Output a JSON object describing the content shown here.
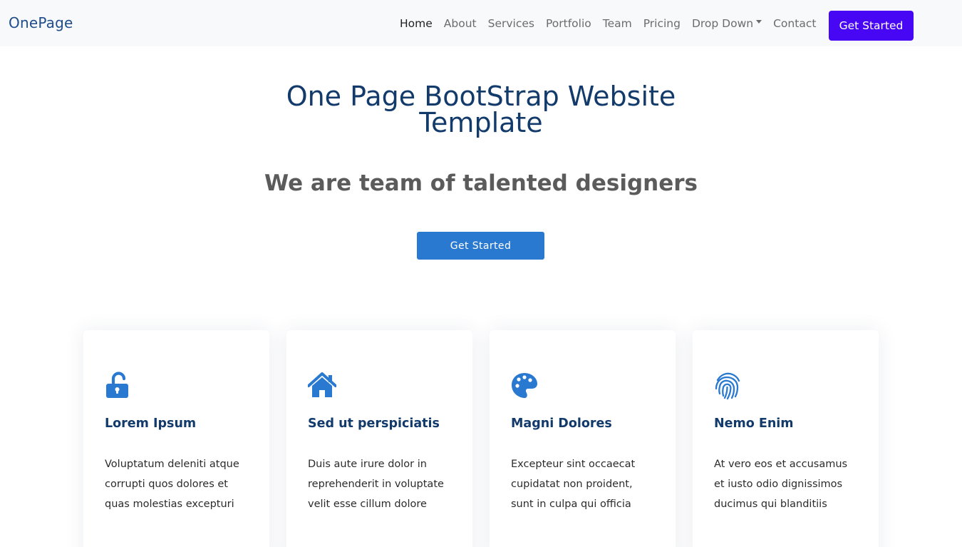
{
  "navbar": {
    "brand": "OnePage",
    "links": [
      {
        "label": "Home",
        "active": true
      },
      {
        "label": "About"
      },
      {
        "label": "Services"
      },
      {
        "label": "Portfolio"
      },
      {
        "label": "Team"
      },
      {
        "label": "Pricing"
      },
      {
        "label": "Drop Down",
        "dropdown": true
      },
      {
        "label": "Contact"
      }
    ],
    "cta_label": "Get Started"
  },
  "hero": {
    "title_line1": "One Page BootStrap Website",
    "title_line2": "Template",
    "subtitle": "We are team of talented designers",
    "cta_label": "Get Started"
  },
  "features": [
    {
      "icon": "lock-open-icon",
      "title": "Lorem Ipsum",
      "text": "Voluptatum deleniti atque corrupti quos dolores et quas molestias excepturi"
    },
    {
      "icon": "house-icon",
      "title": "Sed ut perspiciatis",
      "text": "Duis aute irure dolor in reprehenderit in voluptate velit esse cillum dolore"
    },
    {
      "icon": "palette-icon",
      "title": "Magni Dolores",
      "text": "Excepteur sint occaecat cupidatat non proident, sunt in culpa qui officia"
    },
    {
      "icon": "fingerprint-icon",
      "title": "Nemo Enim",
      "text": "At vero eos et accusamus et iusto odio dignissimos ducimus qui blanditiis"
    }
  ],
  "colors": {
    "nav_cta": "#4807f4",
    "hero_cta": "#2a79d0",
    "icon": "#2a79d0",
    "heading": "#123a6b"
  }
}
